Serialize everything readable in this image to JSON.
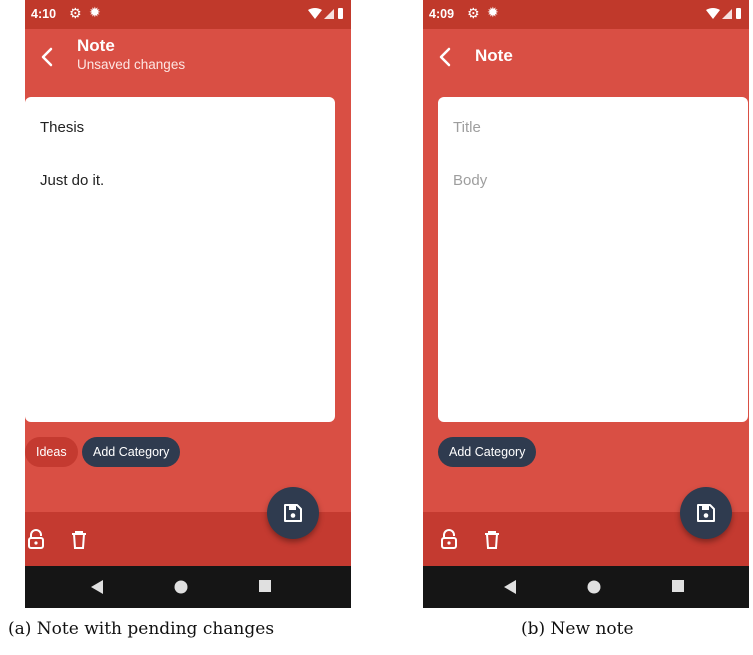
{
  "colors": {
    "primary": "#d94f44",
    "status_bar": "#c0392b",
    "accent_dark": "#2f3b4f",
    "chip_category": "#c43a30",
    "nav_bar": "#151515"
  },
  "screen_a": {
    "status_time": "4:10",
    "app_title": "Note",
    "subtitle": "Unsaved changes",
    "note_title": "Thesis",
    "note_body": "Just do it.",
    "category_chip": "Ideas",
    "add_category": "Add Category",
    "caption": "(a) Note with pending changes"
  },
  "screen_b": {
    "status_time": "4:09",
    "app_title": "Note",
    "title_placeholder": "Title",
    "body_placeholder": "Body",
    "add_category": "Add Category",
    "caption": "(b) New note"
  },
  "icons": {
    "back": "chevron-left-icon",
    "settings": "gear-icon",
    "debug": "bug-icon",
    "wifi": "wifi-icon",
    "signal": "signal-icon",
    "battery": "battery-icon",
    "lock": "lock-icon",
    "delete": "trash-icon",
    "save": "save-icon",
    "nav_back": "nav-back-icon",
    "nav_home": "nav-home-icon",
    "nav_recents": "nav-recents-icon"
  }
}
